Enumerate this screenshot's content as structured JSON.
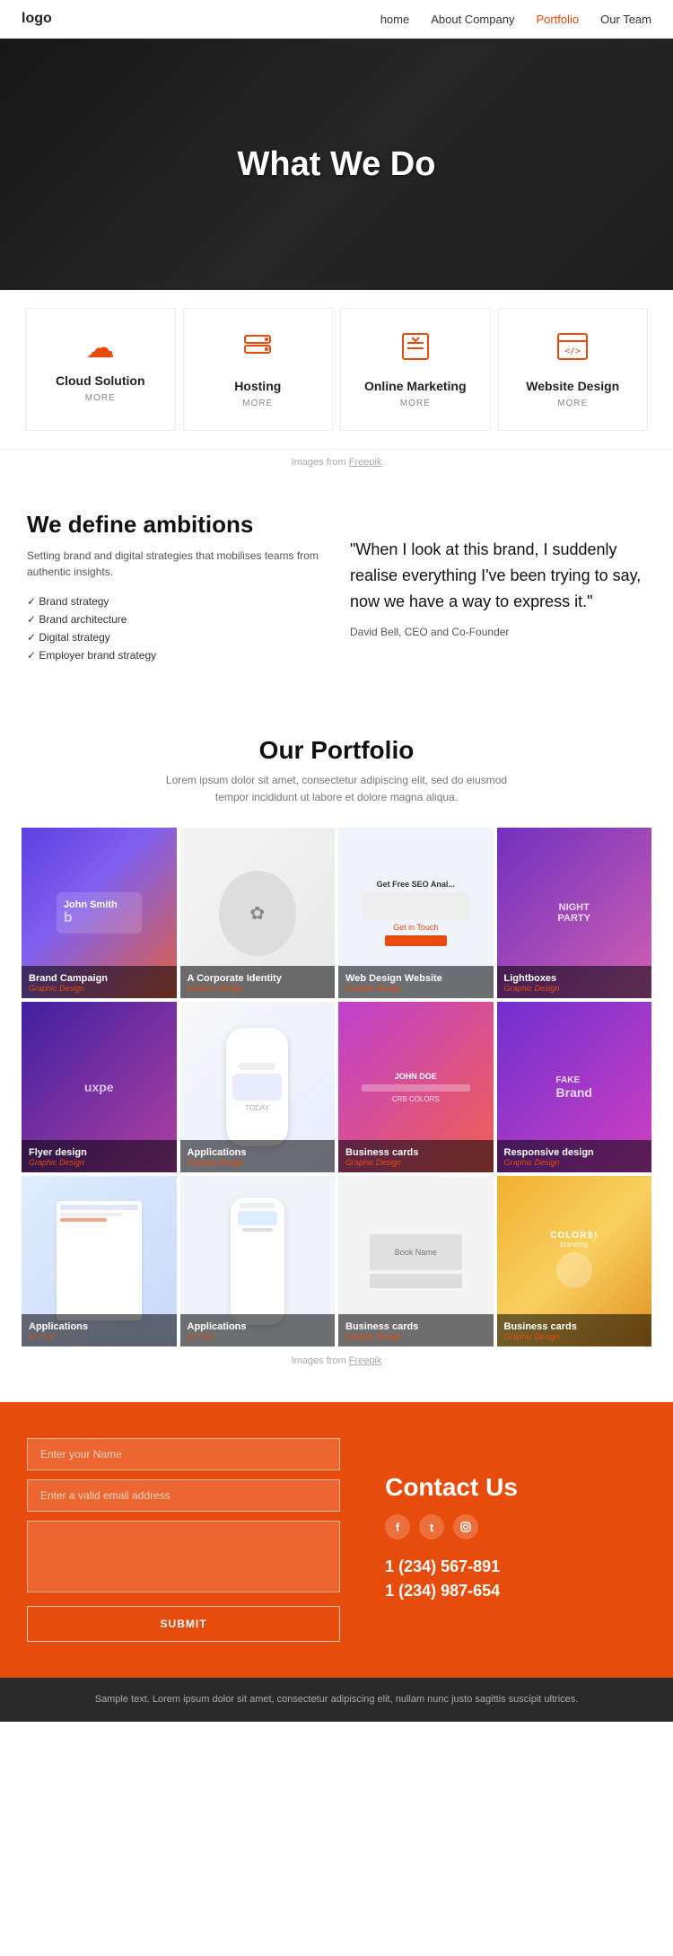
{
  "nav": {
    "logo": "logo",
    "links": [
      {
        "label": "home",
        "href": "#",
        "active": false
      },
      {
        "label": "About Company",
        "href": "#",
        "active": false
      },
      {
        "label": "Portfolio",
        "href": "#",
        "active": true
      },
      {
        "label": "Our Team",
        "href": "#",
        "active": false
      }
    ]
  },
  "hero": {
    "title": "What We Do"
  },
  "services": {
    "items": [
      {
        "icon": "☁",
        "title": "Cloud Solution",
        "more": "MORE"
      },
      {
        "icon": "☰",
        "title": "Hosting",
        "more": "MORE"
      },
      {
        "icon": "✅",
        "title": "Online Marketing",
        "more": "MORE"
      },
      {
        "icon": "</>",
        "title": "Website Design",
        "more": "MORE"
      }
    ],
    "credit": "Images from Freepik"
  },
  "ambitions": {
    "title": "We define ambitions",
    "subtitle": "Setting brand and digital strategies that mobilises teams from authentic insights.",
    "list": [
      "Brand strategy",
      "Brand architecture",
      "Digital strategy",
      "Employer brand strategy"
    ],
    "quote": "\"When I look at this brand, I suddenly realise everything I've been trying to say, now we have a way to express it.\"",
    "quote_author": "David Bell, CEO and Co-Founder"
  },
  "portfolio": {
    "title": "Our Portfolio",
    "subtitle": "Lorem ipsum dolor sit amet, consectetur adipiscing elit, sed do eiusmod tempor incididunt ut labore et dolore magna aliqua.",
    "items": [
      {
        "title": "Brand Campaign",
        "category": "Graphic Design",
        "bg": "bg-brand"
      },
      {
        "title": "A Corporate Identity",
        "category": "Graphic Design",
        "bg": "bg-corp"
      },
      {
        "title": "Web Design Website",
        "category": "Graphic Design",
        "bg": "bg-web"
      },
      {
        "title": "Lightboxes",
        "category": "Graphic Design",
        "bg": "bg-light"
      },
      {
        "title": "Flyer design",
        "category": "Graphic Design",
        "bg": "bg-flyer"
      },
      {
        "title": "Applications",
        "category": "Graphic Design",
        "bg": "bg-app1"
      },
      {
        "title": "Business cards",
        "category": "Graphic Design",
        "bg": "bg-biz1"
      },
      {
        "title": "Responsive design",
        "category": "Graphic Design",
        "bg": "bg-resp"
      },
      {
        "title": "Applications",
        "category": "UI / UX",
        "bg": "bg-app2"
      },
      {
        "title": "Applications",
        "category": "UI / UX",
        "bg": "bg-app3"
      },
      {
        "title": "Business cards",
        "category": "Graphic Design",
        "bg": "bg-biz2"
      },
      {
        "title": "Business cards",
        "category": "Graphic Design",
        "bg": "bg-biz3"
      }
    ],
    "credit": "Images from Freepik"
  },
  "contact": {
    "title": "Contact Us",
    "name_placeholder": "Enter your Name",
    "email_placeholder": "Enter a valid email address",
    "message_placeholder": "",
    "submit_label": "SUBMIT",
    "phone1": "1 (234) 567-891",
    "phone2": "1 (234) 987-654",
    "social": [
      "f",
      "t",
      "in"
    ]
  },
  "footer": {
    "text": "Sample text. Lorem ipsum dolor sit amet, consectetur adipiscing elit, nullam nunc justo sagittis suscipit ultrices."
  }
}
